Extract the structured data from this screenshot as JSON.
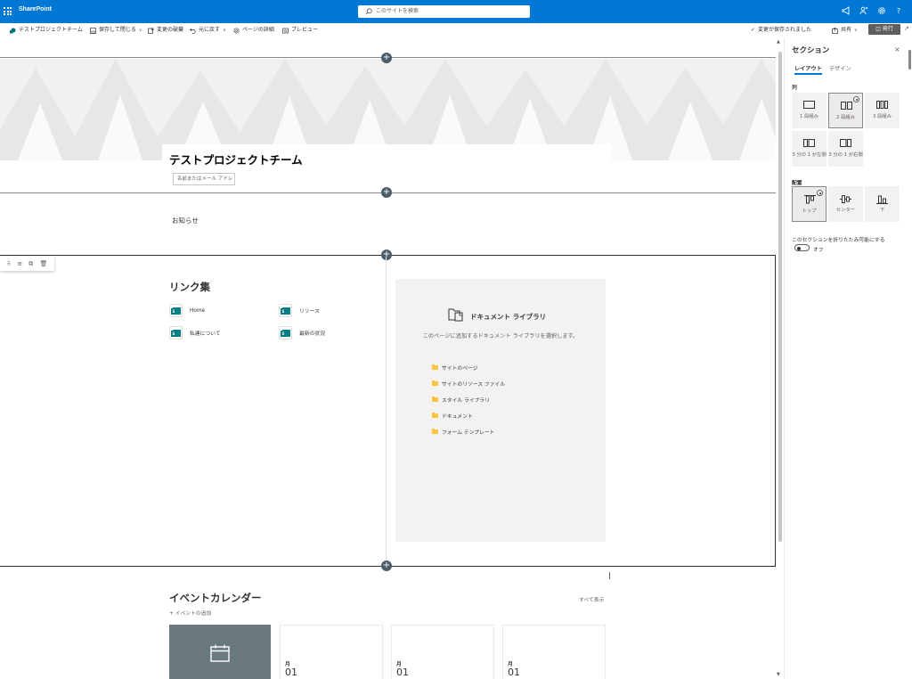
{
  "suite": {
    "brand": "SharePoint",
    "search_placeholder": "このサイトを検索"
  },
  "commands": {
    "site_name": "テストプロジェクトチーム",
    "save_close": "保存して閉じる",
    "discard": "変更の破棄",
    "undo": "元に戻す",
    "page_details": "ページの詳細",
    "preview": "プレビュー",
    "saved_status": "変更が保存されました",
    "share": "共有",
    "publish": "発行"
  },
  "page": {
    "title": "テストプロジェクトチーム",
    "author_placeholder": "名前またはメール アドレ",
    "news_title": "お知らせ"
  },
  "quick_links": {
    "title": "リンク集",
    "items": [
      {
        "label": "Home",
        "tile": "S"
      },
      {
        "label": "リソース",
        "tile": "S"
      },
      {
        "label": "私達について",
        "tile": "S"
      },
      {
        "label": "最新の状況",
        "tile": "S"
      }
    ]
  },
  "document_library": {
    "title": "ドキュメント ライブラリ",
    "description": "このページに追加するドキュメント ライブラリを選択します。",
    "libraries": [
      "サイトのページ",
      "サイトのリソース ファイル",
      "スタイル ライブラリ",
      "ドキュメント",
      "フォーム テンプレート"
    ]
  },
  "events": {
    "title": "イベントカレンダー",
    "add": "+ イベントの追加",
    "see_all": "すべて表示",
    "cards": [
      {
        "month": "月",
        "day": "01"
      },
      {
        "month": "月",
        "day": "01"
      },
      {
        "month": "月",
        "day": "01"
      }
    ]
  },
  "pane": {
    "title": "セクション",
    "close": "×",
    "tabs": [
      "レイアウト",
      "デザイン"
    ],
    "columns_label": "列",
    "column_options": [
      "1 段組み",
      "2 段組み",
      "3 段組み",
      "3 分の 1 が左側",
      "3 分の 1 が右側"
    ],
    "selected_column": "2 段組み",
    "alignment_label": "配置",
    "alignment_options": [
      "トップ",
      "センター",
      "下"
    ],
    "selected_alignment": "トップ",
    "collapse_label": "このセクションを折りたたみ可能にする",
    "collapse_state": "オフ"
  },
  "colors": {
    "brand": "#0078d4",
    "hero": "#f1f1f1",
    "section_plus": "#4b5d69",
    "event_image": "#69797e"
  }
}
